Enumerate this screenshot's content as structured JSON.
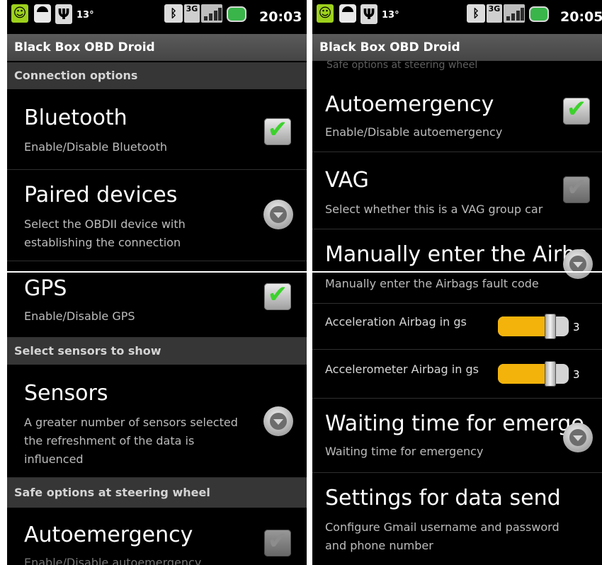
{
  "left": {
    "status": {
      "temp": "13°",
      "net": "3G",
      "time": "20:03"
    },
    "app_title": "Black Box OBD Droid",
    "sections": {
      "connection": "Connection options",
      "sensors": "Select sensors to show",
      "safe": "Safe options at steering wheel"
    },
    "items": {
      "bluetooth": {
        "title": "Bluetooth",
        "summary": "Enable/Disable Bluetooth",
        "checked": true
      },
      "paired": {
        "title": "Paired devices",
        "summary_l1": "Select the OBDII device with",
        "summary_l2": "establishing the connection"
      },
      "gps": {
        "title": "GPS",
        "summary": "Enable/Disable GPS",
        "checked": true
      },
      "sensors": {
        "title": "Sensors",
        "summary_l1": "A greater number of sensors selected",
        "summary_l2": "the refreshment of the data is",
        "summary_l3": "influenced"
      },
      "autoemergency": {
        "title": "Autoemergency",
        "summary": "Enable/Disable autoemergency",
        "checked": false
      }
    }
  },
  "right": {
    "status": {
      "temp": "13°",
      "net": "3G",
      "time": "20:05"
    },
    "app_title": "Black Box OBD Droid",
    "partial_section": "Safe options at steering wheel",
    "items": {
      "autoemergency": {
        "title": "Autoemergency",
        "summary": "Enable/Disable autoemergency",
        "checked": true
      },
      "vag": {
        "title": "VAG",
        "summary": "Select whether this is a VAG group car",
        "checked": false
      },
      "airbag": {
        "title": "Manually enter the Airba",
        "summary": "Manually enter the Airbags fault code"
      },
      "accel_airbag": {
        "title": "Acceleration Airbag in gs",
        "value": "3",
        "fraction": 0.7
      },
      "accelerometer_airbag": {
        "title": "Accelerometer Airbag in gs",
        "value": "3",
        "fraction": 0.7
      },
      "waiting": {
        "title": "Waiting time for emerge",
        "summary": "Waiting time for emergency"
      },
      "data_send": {
        "title": "Settings for data send",
        "summary_l1": "Configure Gmail username and password",
        "summary_l2": "and phone number"
      }
    }
  },
  "colors": {
    "accent_check": "#3cd22c",
    "slider_fill": "#f3b30b",
    "section_bg": "#363636"
  }
}
